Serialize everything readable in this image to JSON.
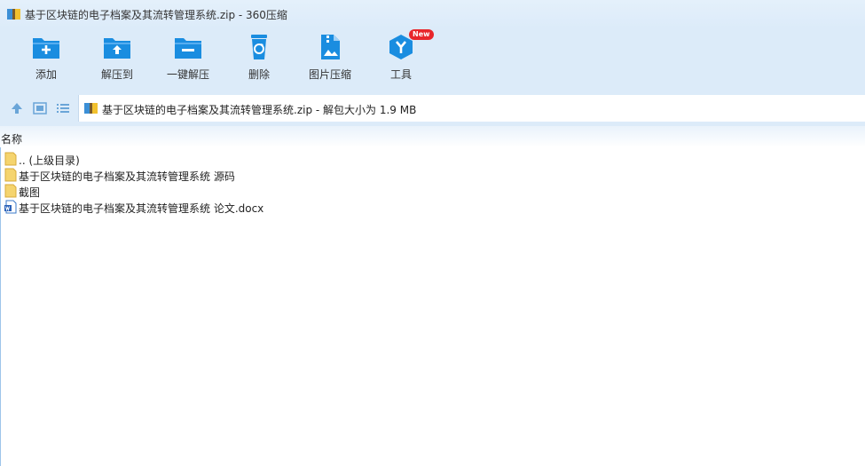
{
  "window": {
    "title": "基于区块链的电子档案及其流转管理系统.zip - 360压缩"
  },
  "toolbar": {
    "add": "添加",
    "extract_to": "解压到",
    "one_click_extract": "一键解压",
    "delete": "删除",
    "image_compress": "图片压缩",
    "tools": "工具",
    "new_badge": "New"
  },
  "address": {
    "path": "基于区块链的电子档案及其流转管理系统.zip - 解包大小为 1.9 MB"
  },
  "list": {
    "column_name": "名称",
    "items": [
      {
        "name": ".. (上级目录)",
        "icon": "folder-up-icon"
      },
      {
        "name": "基于区块链的电子档案及其流转管理系统 源码",
        "icon": "folder-icon"
      },
      {
        "name": "截图",
        "icon": "folder-icon"
      },
      {
        "name": "基于区块链的电子档案及其流转管理系统 论文.docx",
        "icon": "word-doc-icon"
      }
    ]
  },
  "colors": {
    "toolbar_bg": "#dcebf9",
    "accent": "#1a8de0",
    "folder": "#f5d46e",
    "badge": "#e8262b"
  }
}
